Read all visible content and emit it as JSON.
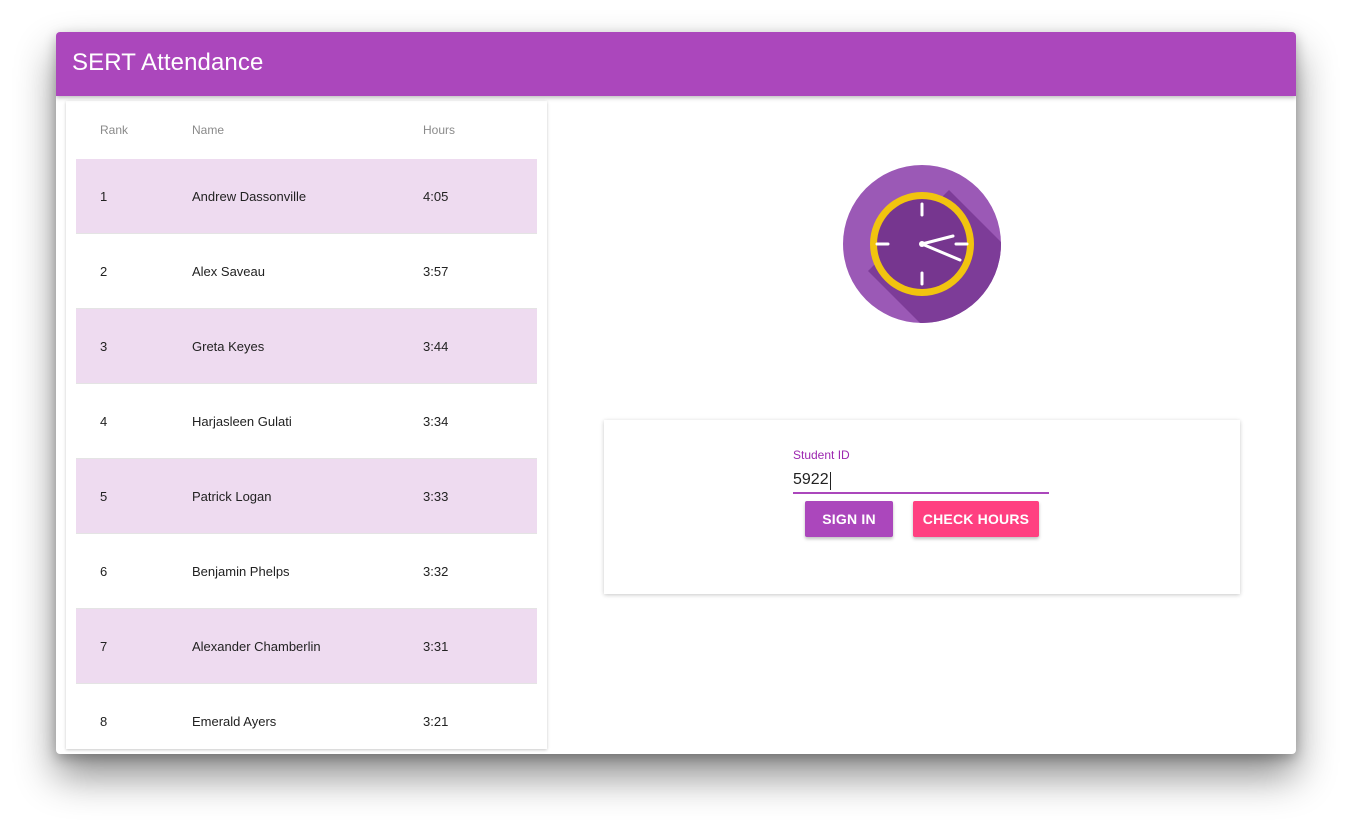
{
  "app": {
    "title": "SERT Attendance"
  },
  "table": {
    "headers": {
      "rank": "Rank",
      "name": "Name",
      "hours": "Hours"
    },
    "rows": [
      {
        "rank": "1",
        "name": "Andrew Dassonville",
        "hours": "4:05"
      },
      {
        "rank": "2",
        "name": "Alex Saveau",
        "hours": "3:57"
      },
      {
        "rank": "3",
        "name": "Greta Keyes",
        "hours": "3:44"
      },
      {
        "rank": "4",
        "name": "Harjasleen Gulati",
        "hours": "3:34"
      },
      {
        "rank": "5",
        "name": "Patrick Logan",
        "hours": "3:33"
      },
      {
        "rank": "6",
        "name": "Benjamin Phelps",
        "hours": "3:32"
      },
      {
        "rank": "7",
        "name": "Alexander Chamberlin",
        "hours": "3:31"
      },
      {
        "rank": "8",
        "name": "Emerald Ayers",
        "hours": "3:21"
      }
    ]
  },
  "form": {
    "student_id_label": "Student ID",
    "student_id_value": "5922",
    "sign_in_label": "SIGN IN",
    "check_hours_label": "CHECK HOURS"
  },
  "icons": {
    "clock": "clock-icon"
  },
  "colors": {
    "primary": "#ab47bc",
    "accent": "#ff4081",
    "row_highlight": "#eedbf0",
    "clock_face": "#9b59b6",
    "clock_ring": "#f1c40f"
  }
}
